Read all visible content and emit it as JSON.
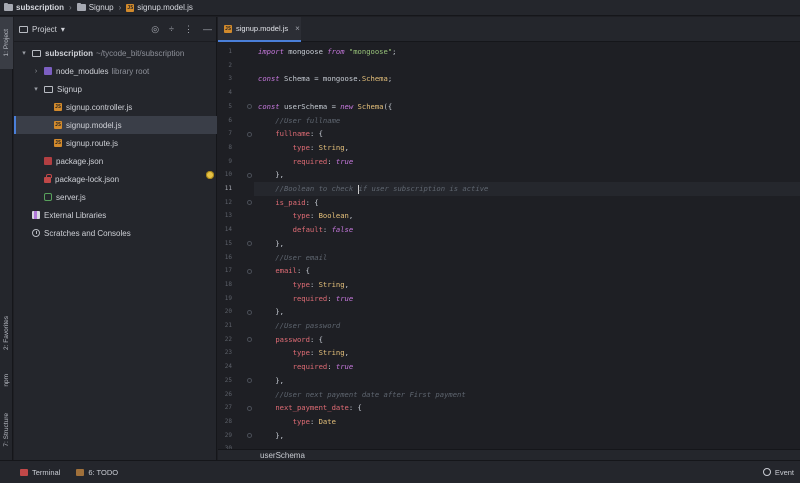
{
  "navbar": {
    "root": "subscription",
    "folder": "Signup",
    "file": "signup.model.js",
    "js_badge": "JS"
  },
  "left_strip": {
    "project_tab": "1: Project",
    "favorites_tab": "2: Favorites",
    "npm_tab": "npm",
    "structure_tab": "7: Structure"
  },
  "project_panel": {
    "title": "Project",
    "dropdown": "▾",
    "tools": [
      "◎",
      "÷",
      "⋮",
      "—"
    ],
    "tree": [
      {
        "label": "subscription",
        "suffix": "~/tycode_bit/subscription",
        "icon": "folder-icon",
        "arrow": "▾"
      },
      {
        "label": "node_modules",
        "suffix": "library root",
        "icon": "library-folder-icon",
        "arrow": "›"
      },
      {
        "label": "Signup",
        "suffix": "",
        "icon": "folder-icon",
        "arrow": "▾"
      },
      {
        "label": "signup.controller.js",
        "suffix": "",
        "icon": "js-file-icon",
        "arrow": ""
      },
      {
        "label": "signup.model.js",
        "suffix": "",
        "icon": "js-file-icon",
        "arrow": ""
      },
      {
        "label": "signup.route.js",
        "suffix": "",
        "icon": "js-file-icon",
        "arrow": ""
      },
      {
        "label": "package.json",
        "suffix": "",
        "icon": "json-file-icon",
        "arrow": ""
      },
      {
        "label": "package-lock.json",
        "suffix": "",
        "icon": "lock-file-icon",
        "arrow": ""
      },
      {
        "label": "server.js",
        "suffix": "",
        "icon": "node-file-icon",
        "arrow": ""
      },
      {
        "label": "External Libraries",
        "suffix": "",
        "icon": "external-libraries-icon",
        "arrow": ""
      },
      {
        "label": "Scratches and Consoles",
        "suffix": "",
        "icon": "scratches-icon",
        "arrow": ""
      }
    ]
  },
  "editor": {
    "tab_label": "signup.model.js",
    "tab_close": "×",
    "bottom_breadcrumb": "userSchema",
    "current_line": 11,
    "line_numbers": [
      "1",
      "2",
      "3",
      "4",
      "5",
      "6",
      "7",
      "8",
      "9",
      "10",
      "11",
      "12",
      "13",
      "14",
      "15",
      "16",
      "17",
      "18",
      "19",
      "20",
      "21",
      "22",
      "23",
      "24",
      "25",
      "26",
      "27",
      "28",
      "29",
      "30"
    ],
    "lines": [
      [
        [
          "import",
          "#c678dd",
          "italic"
        ],
        [
          " mongoose ",
          "#c7ccd4"
        ],
        [
          "from",
          "#c678dd",
          "italic"
        ],
        [
          " ",
          "#c7ccd4"
        ],
        [
          "\"mongoose\"",
          "#98c379"
        ],
        [
          ";",
          "#c7ccd4"
        ]
      ],
      [],
      [
        [
          "const",
          "#c678dd",
          "italic"
        ],
        [
          " Schema = mongoose.",
          "#c7ccd4"
        ],
        [
          "Schema",
          "#e5c07b"
        ],
        [
          ";",
          "#c7ccd4"
        ]
      ],
      [],
      [
        [
          "const",
          "#c678dd",
          "italic"
        ],
        [
          " userSchema = ",
          "#c7ccd4"
        ],
        [
          "new",
          "#c678dd",
          "italic"
        ],
        [
          " ",
          "#c7ccd4"
        ],
        [
          "Schema",
          "#e5c07b"
        ],
        [
          "({",
          "#c7ccd4"
        ]
      ],
      [
        [
          "    //User fullname",
          "#5f6670",
          "italic"
        ]
      ],
      [
        [
          "    ",
          "#c7ccd4"
        ],
        [
          "fullname",
          "#e06c75"
        ],
        [
          ": {",
          "#c7ccd4"
        ]
      ],
      [
        [
          "        ",
          "#c7ccd4"
        ],
        [
          "type",
          "#e06c75"
        ],
        [
          ": ",
          "#c7ccd4"
        ],
        [
          "String",
          "#e5c07b"
        ],
        [
          ",",
          "#c7ccd4"
        ]
      ],
      [
        [
          "        ",
          "#c7ccd4"
        ],
        [
          "required",
          "#e06c75"
        ],
        [
          ": ",
          "#c7ccd4"
        ],
        [
          "true",
          "#c678dd",
          "italic"
        ]
      ],
      [
        [
          "    },",
          "#c7ccd4"
        ]
      ],
      [
        [
          "    //Boolean to check ",
          "#5f6670",
          "italic"
        ],
        [
          "|",
          "caret"
        ],
        [
          "if user subscription is active",
          "#5f6670",
          "italic"
        ]
      ],
      [
        [
          "    ",
          "#c7ccd4"
        ],
        [
          "is_paid",
          "#e06c75"
        ],
        [
          ": {",
          "#c7ccd4"
        ]
      ],
      [
        [
          "        ",
          "#c7ccd4"
        ],
        [
          "type",
          "#e06c75"
        ],
        [
          ": ",
          "#c7ccd4"
        ],
        [
          "Boolean",
          "#e5c07b"
        ],
        [
          ",",
          "#c7ccd4"
        ]
      ],
      [
        [
          "        ",
          "#c7ccd4"
        ],
        [
          "default",
          "#e06c75"
        ],
        [
          ": ",
          "#c7ccd4"
        ],
        [
          "false",
          "#c678dd",
          "italic"
        ]
      ],
      [
        [
          "    },",
          "#c7ccd4"
        ]
      ],
      [
        [
          "    //User email",
          "#5f6670",
          "italic"
        ]
      ],
      [
        [
          "    ",
          "#c7ccd4"
        ],
        [
          "email",
          "#e06c75"
        ],
        [
          ": {",
          "#c7ccd4"
        ]
      ],
      [
        [
          "        ",
          "#c7ccd4"
        ],
        [
          "type",
          "#e06c75"
        ],
        [
          ": ",
          "#c7ccd4"
        ],
        [
          "String",
          "#e5c07b"
        ],
        [
          ",",
          "#c7ccd4"
        ]
      ],
      [
        [
          "        ",
          "#c7ccd4"
        ],
        [
          "required",
          "#e06c75"
        ],
        [
          ": ",
          "#c7ccd4"
        ],
        [
          "true",
          "#c678dd",
          "italic"
        ]
      ],
      [
        [
          "    },",
          "#c7ccd4"
        ]
      ],
      [
        [
          "    //User password",
          "#5f6670",
          "italic"
        ]
      ],
      [
        [
          "    ",
          "#c7ccd4"
        ],
        [
          "password",
          "#e06c75"
        ],
        [
          ": {",
          "#c7ccd4"
        ]
      ],
      [
        [
          "        ",
          "#c7ccd4"
        ],
        [
          "type",
          "#e06c75"
        ],
        [
          ": ",
          "#c7ccd4"
        ],
        [
          "String",
          "#e5c07b"
        ],
        [
          ",",
          "#c7ccd4"
        ]
      ],
      [
        [
          "        ",
          "#c7ccd4"
        ],
        [
          "required",
          "#e06c75"
        ],
        [
          ": ",
          "#c7ccd4"
        ],
        [
          "true",
          "#c678dd",
          "italic"
        ]
      ],
      [
        [
          "    },",
          "#c7ccd4"
        ]
      ],
      [
        [
          "    //User next payment date after First payment",
          "#5f6670",
          "italic"
        ]
      ],
      [
        [
          "    ",
          "#c7ccd4"
        ],
        [
          "next_payment_date",
          "#e06c75"
        ],
        [
          ": {",
          "#c7ccd4"
        ]
      ],
      [
        [
          "        ",
          "#c7ccd4"
        ],
        [
          "type",
          "#e06c75"
        ],
        [
          ": ",
          "#c7ccd4"
        ],
        [
          "Date",
          "#e5c07b"
        ]
      ],
      [
        [
          "    },",
          "#c7ccd4"
        ]
      ],
      []
    ]
  },
  "statusbar": {
    "terminal": "Terminal",
    "todo": "6: TODO",
    "event": "Event"
  },
  "colors": {
    "accent": "#4a7fd9",
    "keyword": "#c678dd",
    "string": "#98c379",
    "property": "#e06c75",
    "type": "#e5c07b",
    "comment": "#5f6670"
  }
}
